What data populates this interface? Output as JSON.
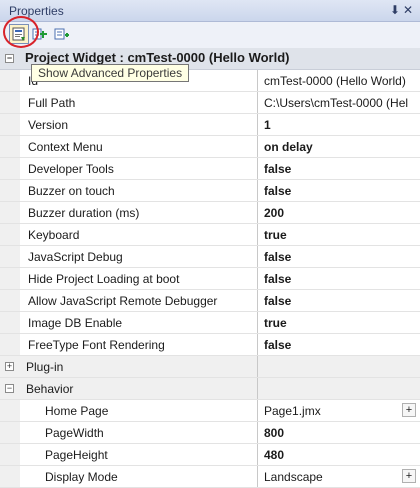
{
  "panel": {
    "title": "Properties",
    "controls": "⬇ ✕"
  },
  "toolbar": {
    "buttons": [
      {
        "name": "show-advanced-properties-button",
        "icon": "advanced-properties-icon"
      },
      {
        "name": "categorized-view-button",
        "icon": "categorized-icon"
      },
      {
        "name": "alphabetical-view-button",
        "icon": "alphabetical-icon"
      }
    ]
  },
  "tooltip": "Show Advanced Properties",
  "header": "Project Widget : cmTest-0000 (Hello World)",
  "properties": [
    {
      "name": "Id",
      "value": "cmTest-0000 (Hello World)",
      "bold": false
    },
    {
      "name": "Full Path",
      "value": "C:\\Users\\cmTest-0000 (Hel",
      "bold": false
    },
    {
      "name": "Version",
      "value": "1",
      "bold": true
    },
    {
      "name": "Context Menu",
      "value": "on delay",
      "bold": true
    },
    {
      "name": "Developer Tools",
      "value": "false",
      "bold": true
    },
    {
      "name": "Buzzer on touch",
      "value": "false",
      "bold": true
    },
    {
      "name": "Buzzer duration (ms)",
      "value": "200",
      "bold": true
    },
    {
      "name": "Keyboard",
      "value": "true",
      "bold": true
    },
    {
      "name": "JavaScript Debug",
      "value": "false",
      "bold": true
    },
    {
      "name": "Hide Project Loading at boot",
      "value": "false",
      "bold": true
    },
    {
      "name": "Allow JavaScript Remote Debugger",
      "value": "false",
      "bold": true
    },
    {
      "name": "Image DB Enable",
      "value": "true",
      "bold": true
    },
    {
      "name": "FreeType Font Rendering",
      "value": "false",
      "bold": true
    }
  ],
  "categories": [
    {
      "label": "Plug-in",
      "expander": "+",
      "expanded": false
    },
    {
      "label": "Behavior",
      "expander": "−",
      "expanded": true
    }
  ],
  "behavior": [
    {
      "name": "Home Page",
      "value": "Page1.jmx",
      "bold": false,
      "button": "+"
    },
    {
      "name": "PageWidth",
      "value": "800",
      "bold": true
    },
    {
      "name": "PageHeight",
      "value": "480",
      "bold": true
    },
    {
      "name": "Display Mode",
      "value": "Landscape",
      "bold": false,
      "button": "+"
    }
  ],
  "colors": {
    "highlight_circle": "#d8232a",
    "title_text": "#2f3e66"
  }
}
